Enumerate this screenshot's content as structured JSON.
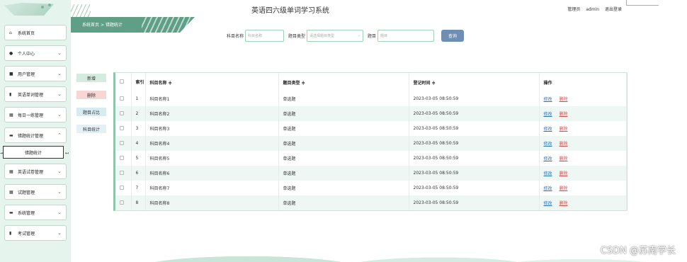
{
  "app_title": "英语四六级单词学习系统",
  "user": {
    "role_label": "管理员",
    "username": "admin",
    "logout_label": "退出登录"
  },
  "breadcrumb": {
    "home": "系统首页",
    "separator": ">",
    "current": "错题统计"
  },
  "sidebar": {
    "items": [
      {
        "label": "系统首页",
        "icon": "home-icon",
        "glyph": "⌂"
      },
      {
        "label": "个人中心",
        "icon": "user-icon",
        "glyph": "●"
      },
      {
        "label": "用户管理",
        "icon": "users-icon",
        "glyph": "■"
      },
      {
        "label": "英语单词管理",
        "icon": "chart-icon",
        "glyph": "▮"
      },
      {
        "label": "每日一练管理",
        "icon": "grid-icon",
        "glyph": "▦"
      },
      {
        "label": "错题统计管理",
        "icon": "stack-icon",
        "glyph": "▬"
      },
      {
        "label": "英语试卷管理",
        "icon": "grid-icon",
        "glyph": "▦"
      },
      {
        "label": "试题管理",
        "icon": "grid-icon",
        "glyph": "▦"
      },
      {
        "label": "系统管理",
        "icon": "chat-icon",
        "glyph": "▬"
      },
      {
        "label": "考试管理",
        "icon": "doc-icon",
        "glyph": "▮"
      }
    ],
    "submenu_active": "错题统计"
  },
  "search": {
    "subject_label": "科目名称",
    "subject_placeholder": "科目名称",
    "type_label": "题目类型",
    "type_placeholder": "请选择题目类型",
    "question_label": "题目",
    "question_placeholder": "题目",
    "button_label": "查询"
  },
  "actions": {
    "add": "新增",
    "delete": "删除",
    "stat1": "题目占比",
    "stat2": "科目统计"
  },
  "table": {
    "headers": {
      "index": "索引",
      "subject": "科目名称 ≑",
      "type": "题目类型 ≑",
      "time": "登记时间 ≑",
      "ops": "操作"
    },
    "rows": [
      {
        "index": "1",
        "subject": "科目名称1",
        "type": "单选题",
        "time": "2023-03-05 08:50:59"
      },
      {
        "index": "2",
        "subject": "科目名称2",
        "type": "单选题",
        "time": "2023-03-05 08:50:59"
      },
      {
        "index": "3",
        "subject": "科目名称3",
        "type": "单选题",
        "time": "2023-03-05 08:50:59"
      },
      {
        "index": "4",
        "subject": "科目名称4",
        "type": "单选题",
        "time": "2023-03-05 08:50:59"
      },
      {
        "index": "5",
        "subject": "科目名称5",
        "type": "单选题",
        "time": "2023-03-05 08:50:59"
      },
      {
        "index": "6",
        "subject": "科目名称6",
        "type": "单选题",
        "time": "2023-03-05 08:50:59"
      },
      {
        "index": "7",
        "subject": "科目名称7",
        "type": "单选题",
        "time": "2023-03-05 08:50:59"
      },
      {
        "index": "8",
        "subject": "科目名称8",
        "type": "单选题",
        "time": "2023-03-05 08:50:59"
      }
    ],
    "edit_label": "修改",
    "delete_label": "删除"
  },
  "watermark": "CSDN @苏南学长",
  "colors": {
    "accent": "#5f9f88",
    "button": "#6e8fb3",
    "row_alt": "#eef7f3",
    "danger": "#d05050",
    "link": "#2f73b9"
  }
}
